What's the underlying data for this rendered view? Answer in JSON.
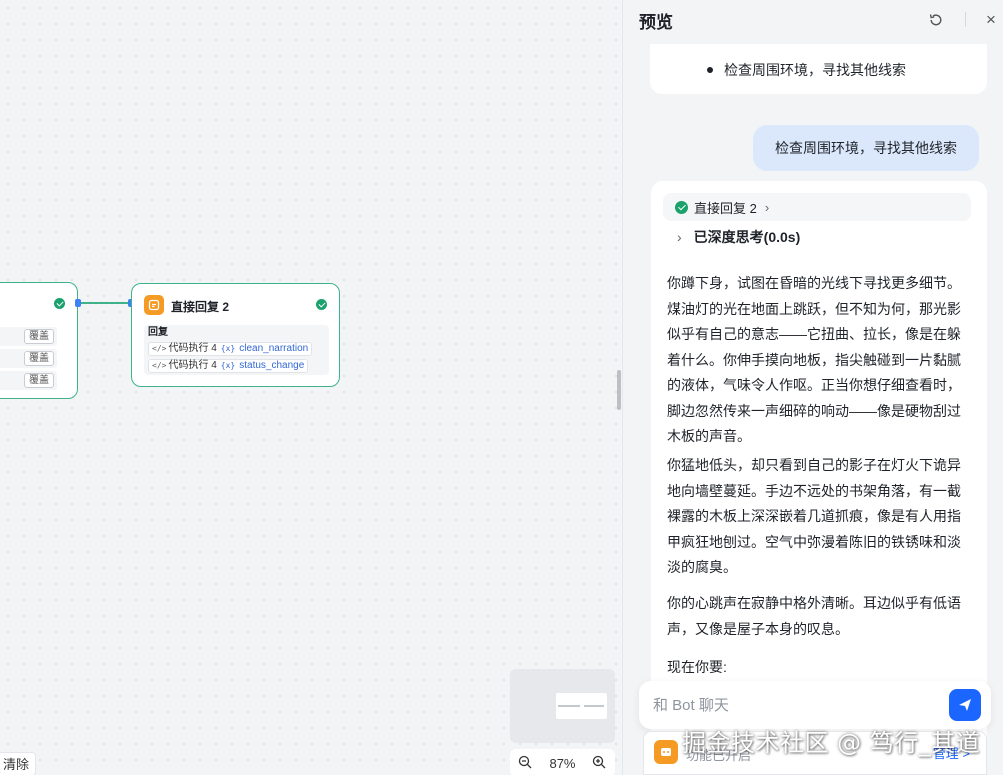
{
  "canvas": {
    "left_node": {
      "tags": [
        "覆盖",
        "覆盖",
        "覆盖"
      ]
    },
    "main_node": {
      "title": "直接回复 2",
      "section_label": "回复",
      "vars": [
        {
          "source": "代码执行 4",
          "name": "clean_narration"
        },
        {
          "source": "代码执行 4",
          "name": "status_change"
        }
      ]
    },
    "zoom": "87%",
    "clear_label": "清除"
  },
  "preview": {
    "title": "预览",
    "prev_list_item": "检查周围环境，寻找其他线索",
    "user_message": "检查周围环境，寻找其他线索",
    "step_label": "直接回复 2",
    "thinking_label": "已深度思考(0.0s)",
    "paragraphs": [
      "你蹲下身，试图在昏暗的光线下寻找更多细节。煤油灯的光在地面上跳跃，但不知为何，那光影似乎有自己的意志——它扭曲、拉长，像是在躲着什么。你伸手摸向地板，指尖触碰到一片黏腻的液体，气味令人作呕。正当你想仔细查看时，脚边忽然传来一声细碎的响动——像是硬物刮过木板的声音。",
      "你猛地低头，却只看到自己的影子在灯火下诡异地向墙壁蔓延。手边不远处的书架角落，有一截裸露的木板上深深嵌着几道抓痕，像是有人用指甲疯狂地刨过。空气中弥漫着陈旧的铁锈味和淡淡的腐臭。",
      "你的心跳声在寂静中格外清晰。耳边似乎有低语声，又像是屋子本身的叹息。",
      "现在你要:"
    ],
    "input_placeholder": "和 Bot 聊天",
    "feature_text": "功能已开启",
    "manage_label": "管理 >"
  },
  "watermark": "掘金技术社区 @ 笃行_其道",
  "colors": {
    "accent": "#1a66ff",
    "success": "#1aa16c",
    "node_border": "#3fb28a",
    "node_icon": "#f59a23",
    "user_bubble": "#dbe8fb"
  }
}
